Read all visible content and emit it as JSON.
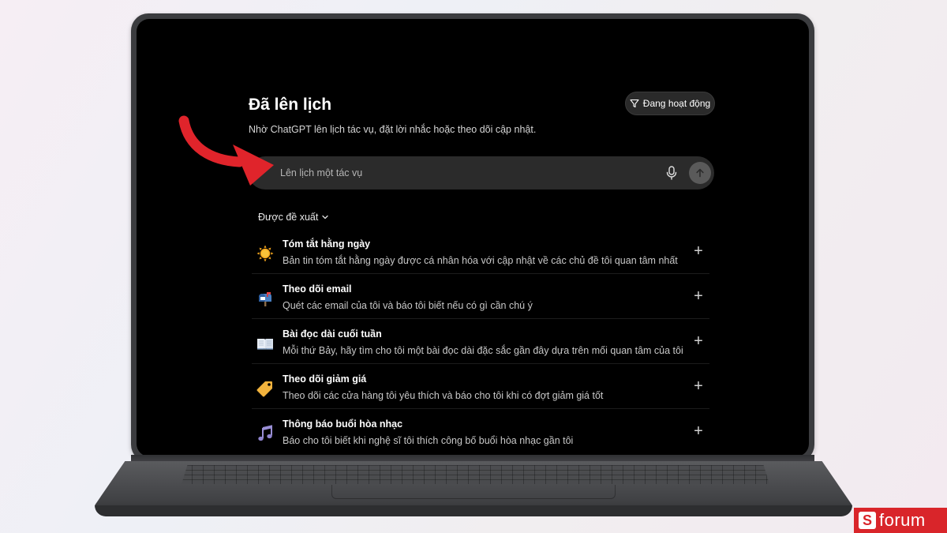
{
  "page": {
    "title": "Đã lên lịch",
    "subtitle": "Nhờ ChatGPT lên lịch tác vụ, đặt lời nhắc hoặc theo dõi cập nhật.",
    "filter_label": "Đang hoạt động"
  },
  "composer": {
    "placeholder": "Lên lịch một tác vụ"
  },
  "suggestions": {
    "header": "Được đề xuất",
    "items": [
      {
        "icon": "sun-icon",
        "title": "Tóm tắt hằng ngày",
        "description": "Bản tin tóm tắt hằng ngày được cá nhân hóa với cập nhật về các chủ đề tôi quan tâm nhất"
      },
      {
        "icon": "mailbox-icon",
        "title": "Theo dõi email",
        "description": "Quét các email của tôi và báo tôi biết nếu có gì cần chú ý"
      },
      {
        "icon": "open-book-icon",
        "title": "Bài đọc dài cuối tuần",
        "description": "Mỗi thứ Bảy, hãy tìm cho tôi một bài đọc dài đặc sắc gần đây dựa trên mối quan tâm của tôi"
      },
      {
        "icon": "price-tag-icon",
        "title": "Theo dõi giảm giá",
        "description": "Theo dõi các cửa hàng tôi yêu thích và báo cho tôi khi có đợt giảm giá tốt"
      },
      {
        "icon": "music-note-icon",
        "title": "Thông báo buổi hòa nhạc",
        "description": "Báo cho tôi biết khi nghệ sĩ tôi thích công bố buổi hòa nhạc gần tôi"
      }
    ]
  },
  "brand": {
    "letter": "S",
    "text": "forum",
    "color": "#d9252a"
  },
  "colors": {
    "screen_bg": "#000000",
    "composer_bg": "#2b2b2b",
    "annotation_arrow": "#e0242b"
  }
}
